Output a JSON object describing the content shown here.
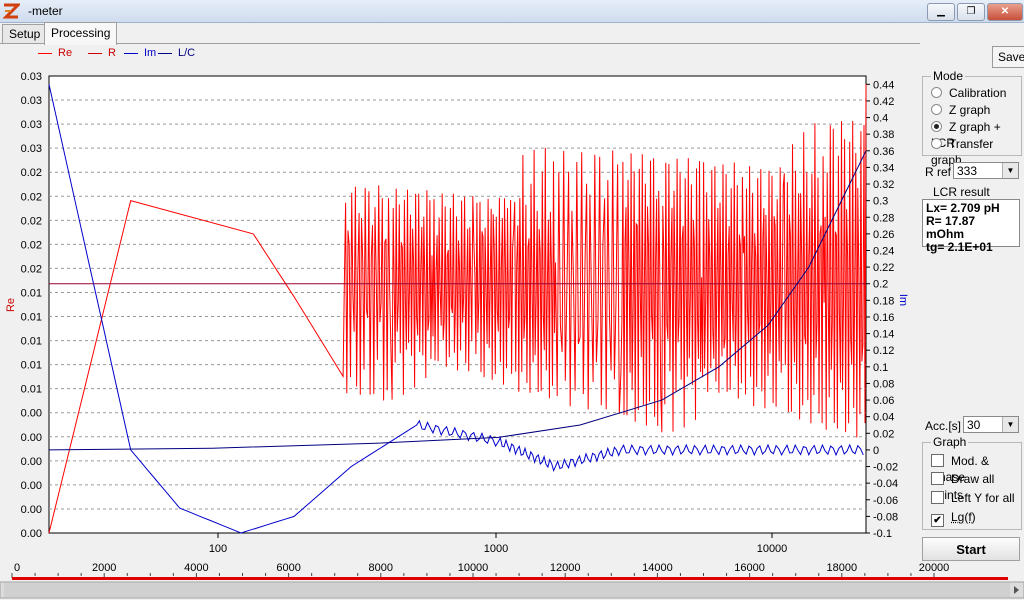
{
  "window": {
    "title": "-meter",
    "minimize": "▁",
    "maximize": "❐",
    "close": "✕"
  },
  "tabs": [
    {
      "label": "Setup"
    },
    {
      "label": "Processing"
    }
  ],
  "legend": [
    {
      "label": "Re",
      "color": "#ff0000"
    },
    {
      "label": "R",
      "color": "#cc0000"
    },
    {
      "label": "Im",
      "color": "#0000cc"
    },
    {
      "label": "L/C",
      "color": "#000080"
    }
  ],
  "toolbar": {
    "save_label": "Save"
  },
  "mode": {
    "title": "Mode",
    "options": [
      "Calibration",
      "Z graph",
      "Z graph + LCR",
      "Transfer graph"
    ],
    "selected": "Z graph + LCR"
  },
  "rref": {
    "label": "R ref",
    "value": "333"
  },
  "lcr_result": {
    "title": "LCR result",
    "lines": [
      "Lx= 2.709 pH",
      "R= 17.87 mOhm",
      "tg= 2.1E+01"
    ]
  },
  "acc": {
    "label": "Acc.[s]",
    "value": "30"
  },
  "graph_opts": {
    "title": "Graph",
    "options": [
      {
        "label": "Mod. & Phase",
        "checked": false
      },
      {
        "label": "Draw all points",
        "checked": false
      },
      {
        "label": "Left Y for all",
        "checked": false
      },
      {
        "label": "Lg(f)",
        "checked": true
      }
    ]
  },
  "start_label": "Start",
  "chart_data": {
    "type": "line",
    "ylabel": "Re",
    "y2label": "Im",
    "left_ticks": [
      "0.03",
      "0.03",
      "0.03",
      "0.03",
      "0.02",
      "0.02",
      "0.02",
      "0.02",
      "0.02",
      "0.01",
      "0.01",
      "0.01",
      "0.01",
      "0.01",
      "0.00",
      "0.00",
      "0.00",
      "0.00",
      "0.00",
      "0.00"
    ],
    "right_ticks": [
      "0.44",
      "0.42",
      "0.4",
      "0.38",
      "0.36",
      "0.34",
      "0.32",
      "0.3",
      "0.28",
      "0.26",
      "0.24",
      "0.22",
      "0.2",
      "0.18",
      "0.16",
      "0.14",
      "0.12",
      "0.1",
      "0.08",
      "0.06",
      "0.04",
      "0.02",
      "0",
      "-0.02",
      "-0.04",
      "-0.06",
      "-0.08",
      "-0.1"
    ],
    "x_log_ticks": [
      "100",
      "1000",
      "10000"
    ],
    "x_linear_ticks": [
      "0",
      "2000",
      "4000",
      "6000",
      "8000",
      "10000",
      "12000",
      "14000",
      "16000",
      "18000",
      "20000"
    ],
    "y2_range": [
      -0.1,
      0.45
    ],
    "series": [
      {
        "name": "Re",
        "color": "#ff0000",
        "x": [
          0.0,
          0.1,
          0.25,
          0.3,
          0.36,
          0.42,
          0.47,
          0.52,
          0.57,
          0.62,
          0.7,
          0.75,
          0.8,
          0.85,
          0.9,
          0.95,
          1.0
        ],
        "y": [
          -0.1,
          0.3,
          0.26,
          0.23,
          0.3,
          0.14,
          0.3,
          0.2,
          0.28,
          0.12,
          0.3,
          0.1,
          0.32,
          0.12,
          0.35,
          0.1,
          0.44
        ]
      },
      {
        "name": "R",
        "color": "#990033",
        "x": [
          0.0,
          1.0
        ],
        "y": [
          0.2,
          0.2
        ]
      },
      {
        "name": "Im",
        "color": "#0000cc",
        "x": [
          0.0,
          0.1,
          0.16,
          0.235,
          0.3,
          0.37,
          0.45,
          0.55,
          0.62,
          0.7,
          0.8,
          0.9,
          1.0
        ],
        "y": [
          0.44,
          0.0,
          -0.07,
          -0.1,
          -0.08,
          -0.02,
          0.03,
          0.01,
          -0.02,
          0.0,
          0.0,
          0.0,
          0.0
        ]
      },
      {
        "name": "L/C",
        "color": "#000080",
        "x": [
          0.0,
          0.2,
          0.4,
          0.55,
          0.65,
          0.75,
          0.82,
          0.88,
          0.93,
          0.97,
          1.0
        ],
        "y": [
          0.0,
          0.002,
          0.008,
          0.015,
          0.03,
          0.06,
          0.1,
          0.15,
          0.22,
          0.3,
          0.36
        ]
      }
    ]
  },
  "slider": {
    "min": 0,
    "max": 20000,
    "value": 0
  }
}
